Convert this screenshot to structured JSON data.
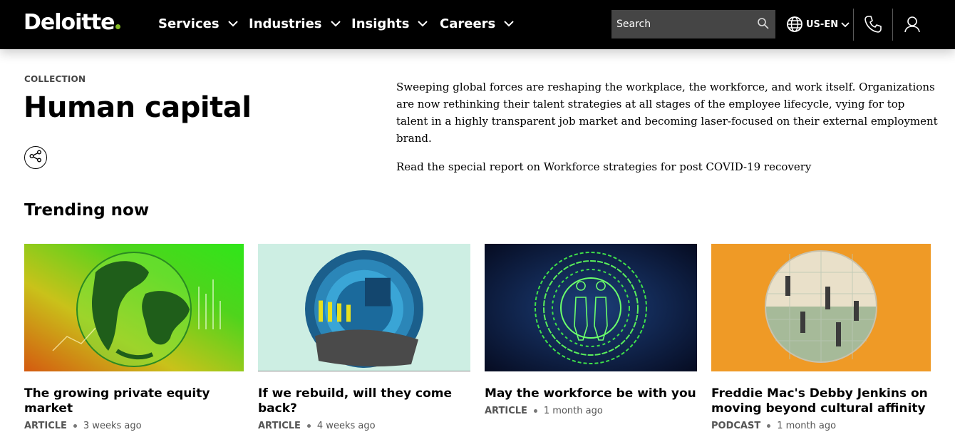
{
  "header": {
    "logo_text": "Deloitte",
    "nav": [
      {
        "label": "Services"
      },
      {
        "label": "Industries"
      },
      {
        "label": "Insights"
      },
      {
        "label": "Careers"
      }
    ],
    "search_placeholder": "Search",
    "locale": "US-EN",
    "icons": [
      "search-icon",
      "globe-icon",
      "phone-icon",
      "user-icon"
    ],
    "brand_color": "#86bc25"
  },
  "hero": {
    "eyebrow": "COLLECTION",
    "title": "Human capital",
    "intro": "Sweeping global forces are reshaping the workplace, the workforce, and work itself. Organizations are now rethinking their talent strategies at all stages of the employee lifecycle, vying for top talent in a highly transparent job market and becoming laser-focused on their external employment brand.",
    "report_link": "Read the special report on Workforce strategies for post COVID-19 recovery"
  },
  "trending": {
    "title": "Trending now",
    "cards": [
      {
        "title": "The growing private equity market",
        "type": "ARTICLE",
        "age": "3 weeks ago"
      },
      {
        "title": "If we rebuild, will they come back?",
        "type": "ARTICLE",
        "age": "4 weeks ago"
      },
      {
        "title": "May the workforce be with you",
        "type": "ARTICLE",
        "age": "1 month ago"
      },
      {
        "title": "Freddie Mac's Debby Jenkins on moving beyond cultural affinity",
        "type": "PODCAST",
        "age": "1 month ago"
      }
    ]
  }
}
